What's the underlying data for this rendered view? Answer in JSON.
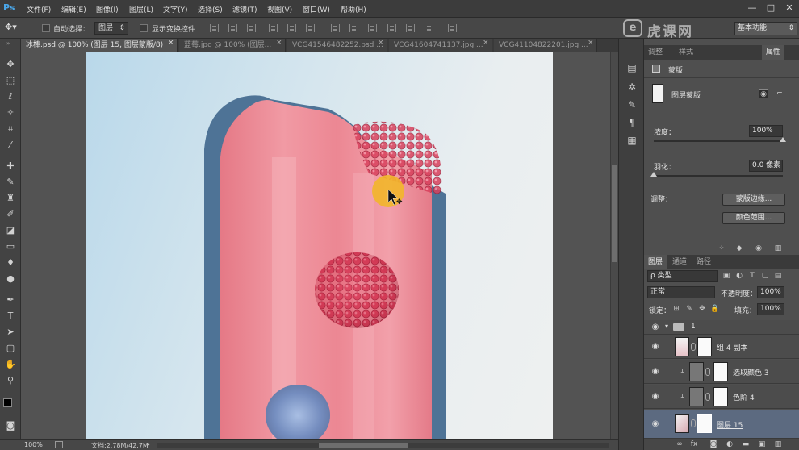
{
  "app": {
    "logo": "Ps"
  },
  "menu": [
    "文件(F)",
    "编辑(E)",
    "图像(I)",
    "图层(L)",
    "文字(Y)",
    "选择(S)",
    "滤镜(T)",
    "视图(V)",
    "窗口(W)",
    "帮助(H)"
  ],
  "window_controls": {
    "minimize": "—",
    "maximize": "□",
    "close": "✕"
  },
  "options": {
    "auto_select_label": "自动选择：",
    "auto_select_value": "图层",
    "show_transform_label": "显示变换控件"
  },
  "tabs": [
    {
      "label": "冰棒.psd @ 100% (图层 15, 图层蒙版/8)",
      "close": "×",
      "active": true
    },
    {
      "label": "蓝莓.jpg @ 100% (图层...",
      "close": "×",
      "active": false
    },
    {
      "label": "VCG41546482252.psd ...",
      "close": "×",
      "active": false
    },
    {
      "label": "VCG41604741137.jpg ...",
      "close": "×",
      "active": false
    },
    {
      "label": "VCG41104822201.jpg ...",
      "close": "×",
      "active": false
    }
  ],
  "status": {
    "zoom": "100%",
    "doc": "文档:2.78M/42.7M"
  },
  "workspace": {
    "value": "基本功能"
  },
  "properties": {
    "tabs": [
      "调整",
      "样式",
      "属性"
    ],
    "title": "蒙版",
    "mask_type": "图层蒙版",
    "density_label": "浓度：",
    "density_value": "100%",
    "feather_label": "羽化：",
    "feather_value": "0.0 像素",
    "adjust_label": "调整：",
    "mask_edge_button": "蒙版边缘...",
    "color_range_button": "颜色范围..."
  },
  "layers_panel": {
    "tabs": [
      "图层",
      "通道",
      "路径"
    ],
    "filter_label": "ρ 类型",
    "blend_mode": "正常",
    "opacity_label": "不透明度：",
    "opacity_value": "100%",
    "lock_label": "锁定：",
    "fill_label": "填充：",
    "fill_value": "100%",
    "group_name": "1",
    "layers": [
      {
        "name": "组 4 副本",
        "selected": false
      },
      {
        "name": "选取颜色 3",
        "selected": false
      },
      {
        "name": "色阶 4",
        "selected": false
      },
      {
        "name": "图层 15",
        "selected": true
      }
    ]
  },
  "watermark": {
    "text": "虎课网",
    "logo_letter": "e"
  },
  "colors": {
    "popsicle_border": "#4e7396",
    "popsicle_body": "#ec8a96",
    "raspberry": "#c8384e",
    "blueberry": "#4a6fb0",
    "cursor_highlight": "#f2b62a"
  }
}
